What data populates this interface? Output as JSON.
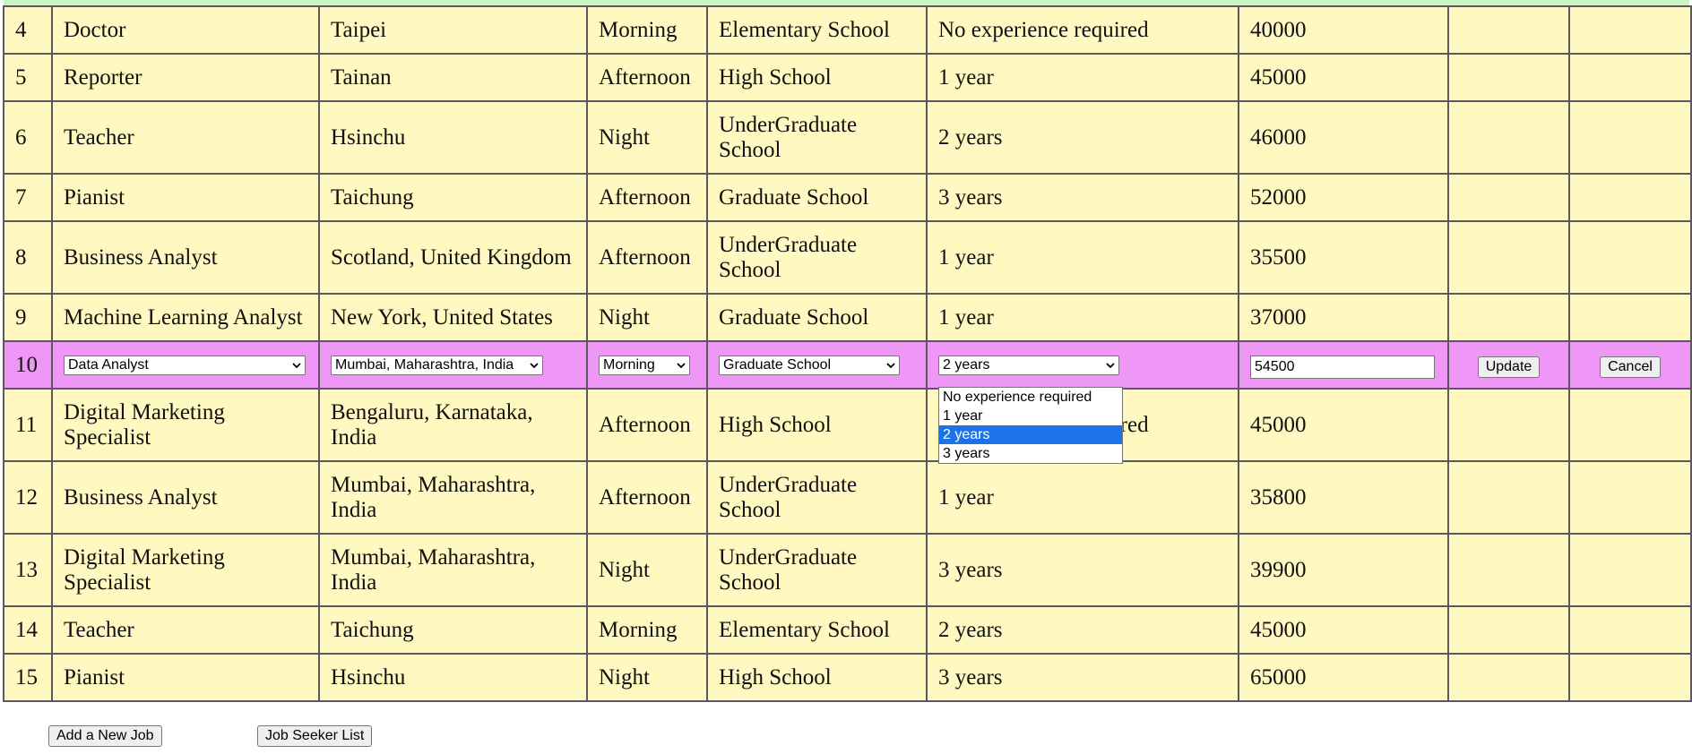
{
  "rows": [
    {
      "id": "4",
      "title": "Doctor",
      "location": "Taipei",
      "shift": "Morning",
      "education": "Elementary School",
      "experience": "No experience required",
      "salary": "40000"
    },
    {
      "id": "5",
      "title": "Reporter",
      "location": "Tainan",
      "shift": "Afternoon",
      "education": "High School",
      "experience": "1 year",
      "salary": "45000"
    },
    {
      "id": "6",
      "title": "Teacher",
      "location": "Hsinchu",
      "shift": "Night",
      "education": "UnderGraduate School",
      "experience": "2 years",
      "salary": "46000"
    },
    {
      "id": "7",
      "title": "Pianist",
      "location": "Taichung",
      "shift": "Afternoon",
      "education": "Graduate School",
      "experience": "3 years",
      "salary": "52000"
    },
    {
      "id": "8",
      "title": "Business Analyst",
      "location": "Scotland, United Kingdom",
      "shift": "Afternoon",
      "education": "UnderGraduate School",
      "experience": "1 year",
      "salary": "35500"
    },
    {
      "id": "9",
      "title": "Machine Learning Analyst",
      "location": "New York, United States",
      "shift": "Night",
      "education": "Graduate School",
      "experience": "1 year",
      "salary": "37000"
    },
    {
      "id": "11",
      "title": "Digital Marketing Specialist",
      "location": "Bengaluru, Karnataka, India",
      "shift": "Afternoon",
      "education": "High School",
      "experience": "No experience required",
      "salary": "45000"
    },
    {
      "id": "12",
      "title": "Business Analyst",
      "location": "Mumbai, Maharashtra, India",
      "shift": "Afternoon",
      "education": "UnderGraduate School",
      "experience": "1 year",
      "salary": "35800"
    },
    {
      "id": "13",
      "title": "Digital Marketing Specialist",
      "location": "Mumbai, Maharashtra, India",
      "shift": "Night",
      "education": "UnderGraduate School",
      "experience": "3 years",
      "salary": "39900"
    },
    {
      "id": "14",
      "title": "Teacher",
      "location": "Taichung",
      "shift": "Morning",
      "education": "Elementary School",
      "experience": "2 years",
      "salary": "45000"
    },
    {
      "id": "15",
      "title": "Pianist",
      "location": "Hsinchu",
      "shift": "Night",
      "education": "High School",
      "experience": "3 years",
      "salary": "65000"
    }
  ],
  "edit_row": {
    "id": "10",
    "title": "Data Analyst",
    "location": "Mumbai, Maharashtra, India",
    "shift": "Morning",
    "education": "Graduate School",
    "experience": "2 years",
    "salary": "54500",
    "update_label": "Update",
    "cancel_label": "Cancel"
  },
  "experience_dropdown": {
    "options": [
      "No experience required",
      "1 year",
      "2 years",
      "3 years"
    ],
    "selected": "2 years"
  },
  "footer": {
    "add_job_label": "Add a New Job",
    "job_seeker_label": "Job Seeker List"
  }
}
